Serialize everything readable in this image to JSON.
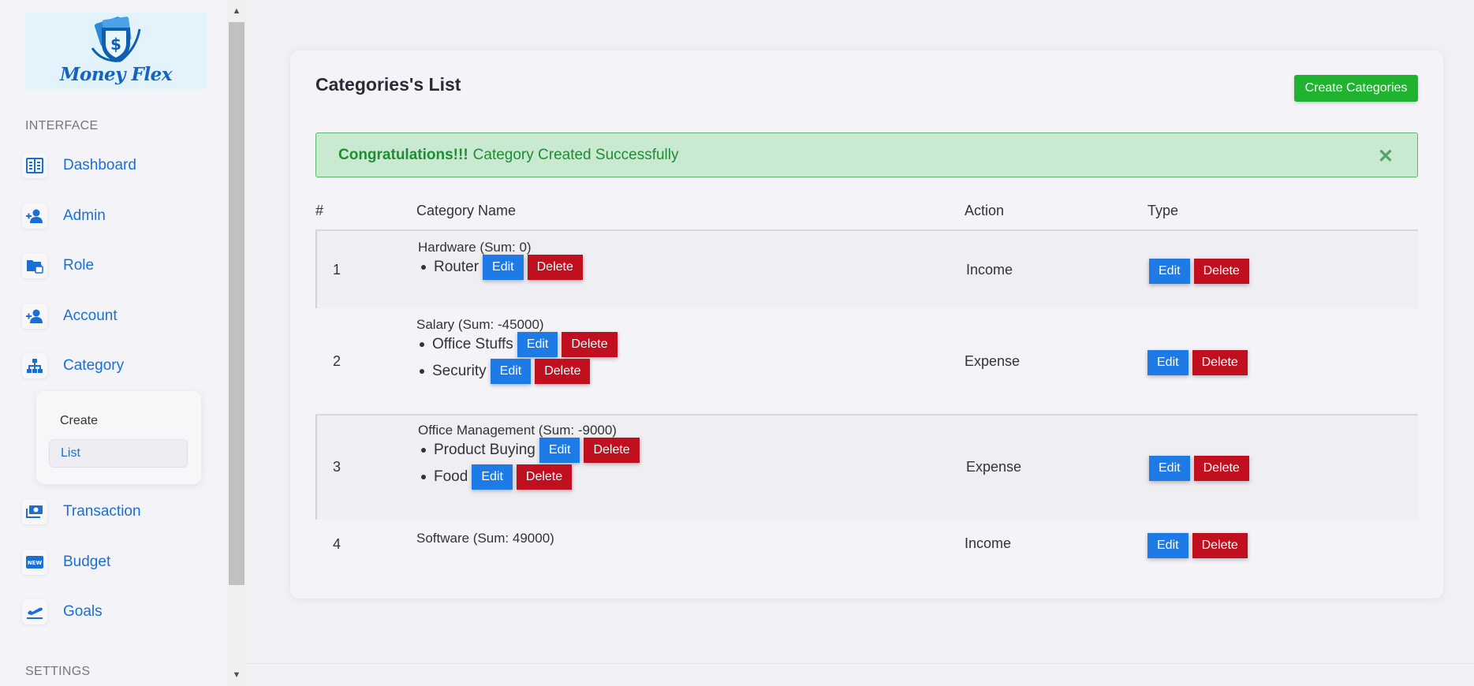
{
  "logo": {
    "text": "Money Flex"
  },
  "sidebar": {
    "section_interface": "INTERFACE",
    "section_settings": "SETTINGS",
    "items": [
      {
        "label": "Dashboard",
        "icon": "dashboard-icon"
      },
      {
        "label": "Admin",
        "icon": "user-plus-icon"
      },
      {
        "label": "Role",
        "icon": "folder-lock-icon"
      },
      {
        "label": "Account",
        "icon": "user-plus-icon"
      },
      {
        "label": "Category",
        "icon": "sitemap-icon"
      },
      {
        "label": "Transaction",
        "icon": "money-icon"
      },
      {
        "label": "Budget",
        "icon": "new-badge-icon"
      },
      {
        "label": "Goals",
        "icon": "plane-departure-icon"
      }
    ],
    "category_submenu": [
      {
        "label": "Create",
        "active": false
      },
      {
        "label": "List",
        "active": true
      }
    ]
  },
  "main": {
    "title": "Categories's List",
    "create_button": "Create Categories",
    "alert": {
      "strong": "Congratulations!!!",
      "message": "Category Created Successfully",
      "close": "✕"
    },
    "table": {
      "headers": [
        "#",
        "Category Name",
        "Action",
        "Type"
      ],
      "edit_label": "Edit",
      "delete_label": "Delete",
      "rows": [
        {
          "num": "1",
          "name": "Hardware (Sum: 0)",
          "subs": [
            "Router"
          ],
          "type": "Income"
        },
        {
          "num": "2",
          "name": "Salary (Sum: -45000)",
          "subs": [
            "Office Stuffs",
            "Security"
          ],
          "type": "Expense"
        },
        {
          "num": "3",
          "name": "Office Management (Sum: -9000)",
          "subs": [
            "Product Buying",
            "Food"
          ],
          "type": "Expense"
        },
        {
          "num": "4",
          "name": "Software (Sum: 49000)",
          "subs": [],
          "type": "Income"
        }
      ]
    }
  },
  "colors": {
    "primary": "#1a6fd6",
    "edit": "#1e7ae5",
    "delete": "#c0101f",
    "create": "#1fb32f",
    "alert_bg": "#c9ead0",
    "alert_text": "#1e8d33"
  }
}
